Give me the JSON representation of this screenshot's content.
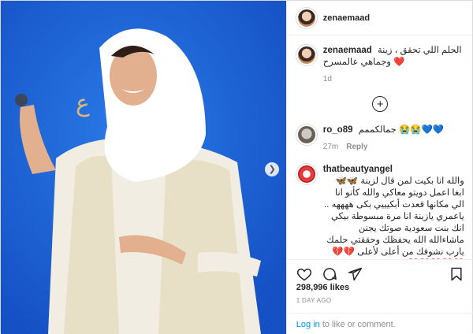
{
  "header": {
    "username": "zenaemaad"
  },
  "caption": {
    "author": "zenaemaad",
    "text": "الحلم اللي تحقق ، زينة وجماهي عالمسرح ❤️",
    "time": "1d"
  },
  "comments": [
    {
      "author": "ro_o89",
      "text": "جمالكممم 😭😭💙💙",
      "time": "27m",
      "reply_label": "Reply"
    },
    {
      "author": "thatbeautyangel",
      "text": "والله انا بكيت لمن قال لزينة 🦋🦋 ابغا اعمل دويتو معاكي والله كأنو انا الي مكانها قعدت أبكيييي بكى ههههه .. ياعمري يازينة انا مرة مبسوطة بيكي انك بنت سعودية صوتك يجنن ماشاءالله الله يحفظك وحققتي حلمك يارب نشوفك من أعلى لأعلى 💔💔💔💔💔💔💔"
    }
  ],
  "stats": {
    "likes": "298,996 likes",
    "date": "1 DAY AGO"
  },
  "login": {
    "link": "Log in",
    "rest": " to like or comment."
  },
  "icons": {
    "like": "heart-icon",
    "comment": "comment-icon",
    "share": "share-icon",
    "save": "bookmark-icon",
    "more_comments": "plus-circle-icon",
    "next": "chevron-right-icon"
  },
  "colors": {
    "background": "#1d5fd3",
    "link": "#0095f6",
    "muted": "#8e8e8e"
  }
}
